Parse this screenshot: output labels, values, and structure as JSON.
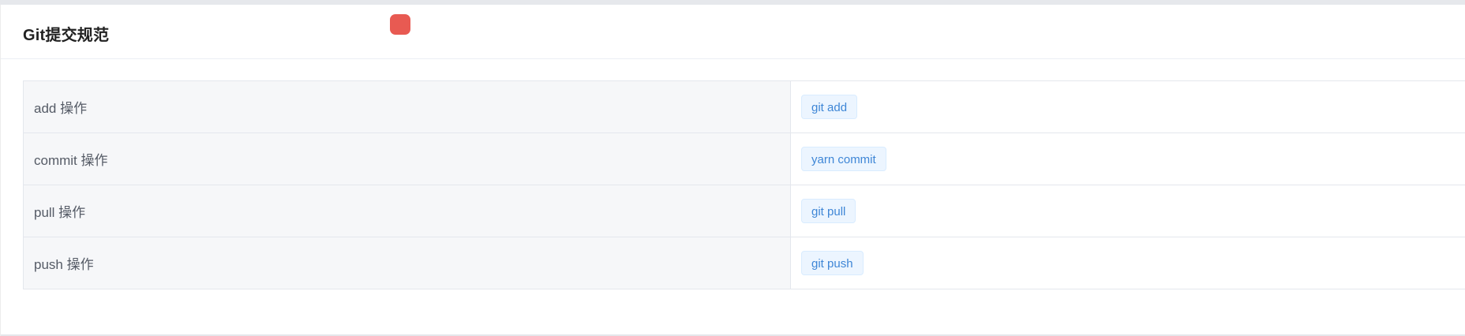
{
  "card": {
    "title": "Git提交规范"
  },
  "rows": [
    {
      "label": "add 操作",
      "command": "git add"
    },
    {
      "label": "commit 操作",
      "command": "yarn commit"
    },
    {
      "label": "pull 操作",
      "command": "git pull"
    },
    {
      "label": "push 操作",
      "command": "git push"
    }
  ],
  "colors": {
    "tag_text": "#3e86d6",
    "tag_bg": "#ecf5ff",
    "label_bg": "#f6f7f9",
    "record_dot": "#e85a52"
  }
}
